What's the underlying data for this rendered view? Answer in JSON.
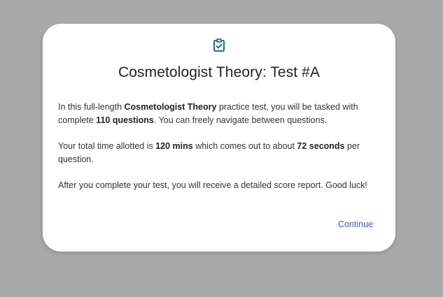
{
  "modal": {
    "icon": "clipboard-check-icon",
    "accent_color": "#1f6f8b",
    "title": "Cosmetologist Theory: Test #A",
    "para1": {
      "t1": "In this full-length ",
      "b1": "Cosmetologist Theory",
      "t2": " practice test, you will be tasked with complete ",
      "b2": "110 questions",
      "t3": ". You can freely navigate between questions."
    },
    "para2": {
      "t1": "Your total time allotted is ",
      "b1": "120 mins",
      "t2": " which comes out to about ",
      "b2": "72 seconds",
      "t3": " per question."
    },
    "para3": "After you complete your test, you will receive a detailed score report. Good luck!",
    "continue_label": "Continue",
    "link_color": "#3b5bb7"
  }
}
